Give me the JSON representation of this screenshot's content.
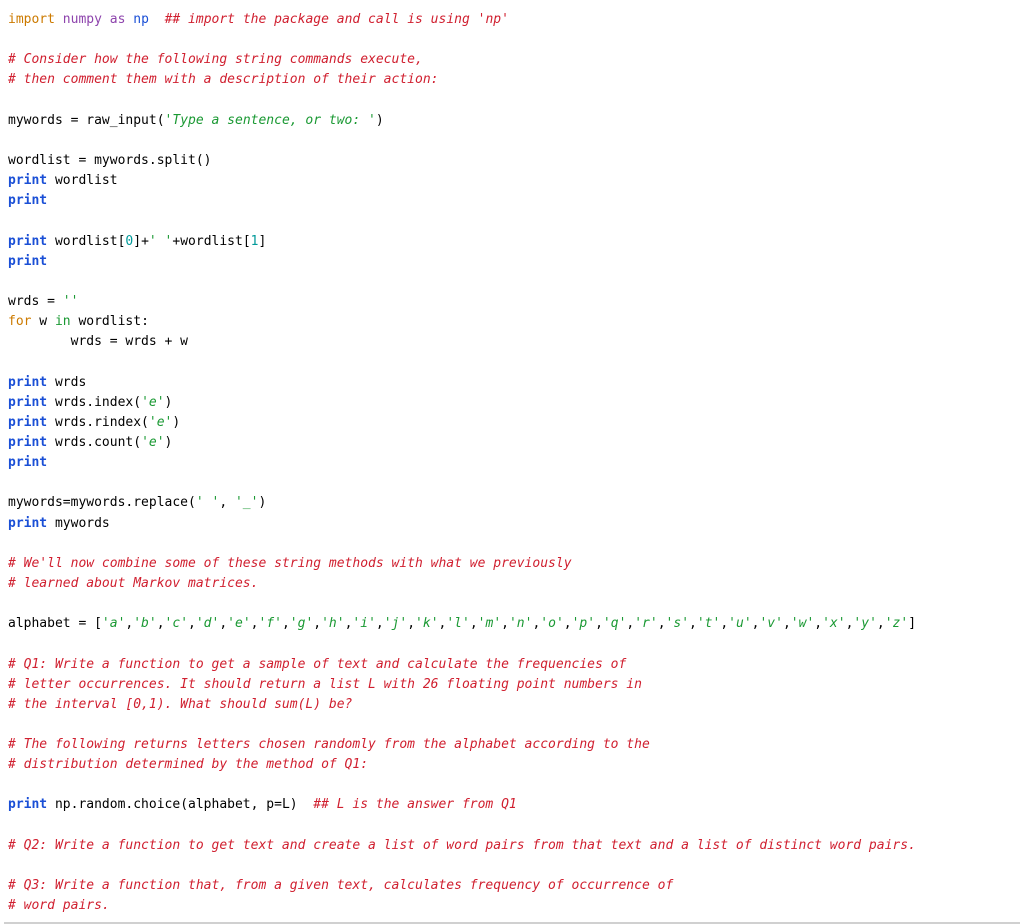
{
  "tokens": {
    "import": "import",
    "numpy": "numpy",
    "as": "as",
    "np": "np",
    "print": "print",
    "for": "for",
    "in": "in",
    "num0": "0",
    "num1": "1"
  },
  "comments": {
    "c_header": "## import the package and call is using 'np'",
    "c1": "# Consider how the following string commands execute,",
    "c2": "# then comment them with a description of their action:",
    "c3": "# We'll now combine some of these string methods with what we previously",
    "c4": "# learned about Markov matrices.",
    "c_q1a": "# Q1: Write a function to get a sample of text and calculate the frequencies of",
    "c_q1b": "# letter occurrences. It should return a list L with 26 floating point numbers in",
    "c_q1c": "# the interval [0,1). What should sum(L) be?",
    "c_randa": "# The following returns letters chosen randomly from the alphabet according to the",
    "c_randb": "# distribution determined by the method of Q1:",
    "c_Lans": "## L is the answer from Q1",
    "c_q2": "# Q2: Write a function to get text and create a list of word pairs from that text and a list of distinct word pairs.",
    "c_q3a": "# Q3: Write a function that, from a given text, calculates frequency of occurrence of",
    "c_q3b": "# word pairs."
  },
  "strings": {
    "s_prompt": "'Type a sentence, or two: '",
    "s_e": "'e'",
    "s_space": "' '",
    "s_us": "'_'",
    "s_empty": "''",
    "s_sp": "' '"
  },
  "code": {
    "mywords_eq": "mywords = raw_input(",
    "close_paren": ")",
    "wordlist_assign": "wordlist = mywords.split()",
    "wordlist": "wordlist",
    "wordlist_idx_l": "wordlist[",
    "wordlist_idx_r": "]+",
    "plus_wordlist_l": "+wordlist[",
    "bracket_r": "]",
    "wrds_eq": "wrds = ",
    "w": " w ",
    "in_wordlist": " wordlist:",
    "wrds_concat": "        wrds = wrds + w",
    "wrds": "wrds",
    "wrds_index": "wrds.index(",
    "wrds_rindex": "wrds.rindex(",
    "wrds_count": "wrds.count(",
    "replace_l": "mywords=mywords.replace(",
    "replace_comma": ", ",
    "mywords": "mywords",
    "alpha_l": "alphabet = [",
    "alpha_r": "]",
    "np_random_l": "np.random.choice(alphabet, p=L)  ",
    "for_tok": "for"
  },
  "alphabet": [
    "'a'",
    "'b'",
    "'c'",
    "'d'",
    "'e'",
    "'f'",
    "'g'",
    "'h'",
    "'i'",
    "'j'",
    "'k'",
    "'l'",
    "'m'",
    "'n'",
    "'o'",
    "'p'",
    "'q'",
    "'r'",
    "'s'",
    "'t'",
    "'u'",
    "'v'",
    "'w'",
    "'x'",
    "'y'",
    "'z'"
  ]
}
